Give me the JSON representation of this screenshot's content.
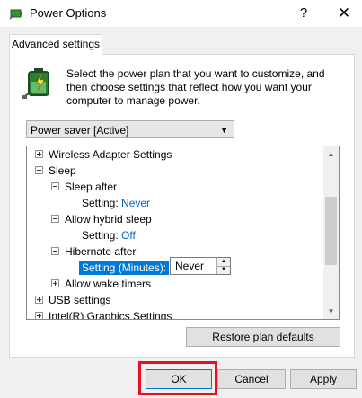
{
  "window": {
    "title": "Power Options",
    "help_label": "?",
    "close_label": "✕"
  },
  "tabs": [
    {
      "label": "Advanced settings"
    }
  ],
  "description": "Select the power plan that you want to customize, and then choose settings that reflect how you want your computer to manage power.",
  "plan_select": {
    "value": "Power saver [Active]"
  },
  "tree": {
    "rows": [
      {
        "label": "Wireless Adapter Settings",
        "expander": "plus"
      },
      {
        "label": "Sleep",
        "expander": "minus"
      },
      {
        "label": "Sleep after",
        "expander": "minus"
      },
      {
        "label": "Setting:",
        "value": "Never"
      },
      {
        "label": "Allow hybrid sleep",
        "expander": "minus"
      },
      {
        "label": "Setting:",
        "value": "Off"
      },
      {
        "label": "Hibernate after",
        "expander": "minus"
      },
      {
        "label": "Setting (Minutes):",
        "value": "Never"
      },
      {
        "label": "Allow wake timers",
        "expander": "plus"
      },
      {
        "label": "USB settings",
        "expander": "plus"
      },
      {
        "label": "Intel(R) Graphics Settings",
        "expander": "plus"
      }
    ]
  },
  "buttons": {
    "restore": "Restore plan defaults",
    "ok": "OK",
    "cancel": "Cancel",
    "apply": "Apply"
  },
  "colors": {
    "link": "#0066cc",
    "selection": "#0078d7",
    "highlight_box": "#e81123"
  }
}
